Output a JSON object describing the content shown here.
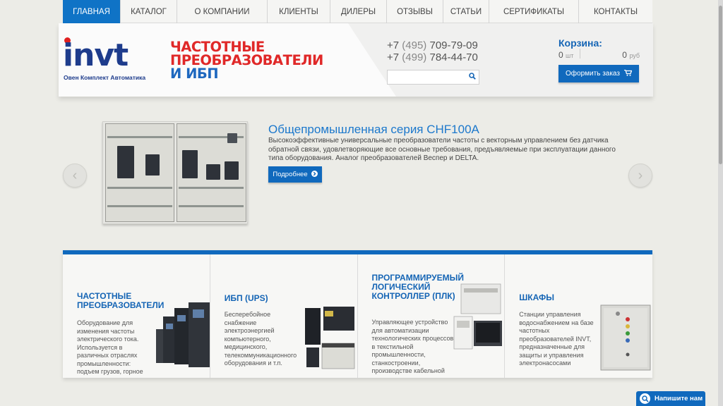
{
  "nav": {
    "items": [
      {
        "label": "Главная"
      },
      {
        "label": "Каталог"
      },
      {
        "label": "О компании"
      },
      {
        "label": "Клиенты"
      },
      {
        "label": "Дилеры"
      },
      {
        "label": "Отзывы"
      },
      {
        "label": "Статьи"
      },
      {
        "label": "Сертификаты"
      },
      {
        "label": "Контакты"
      }
    ]
  },
  "header": {
    "logo_text": "INVT",
    "logo_subtitle": "Овен Комплект Автоматика",
    "headline_line1": "ЧАСТОТНЫЕ",
    "headline_line2": "ПРЕОБРАЗОВАТЕЛИ",
    "headline_line3": "И ИБП",
    "phones": [
      {
        "prefix": "+7",
        "code": "(495)",
        "number": "709-79-09"
      },
      {
        "prefix": "+7",
        "code": "(499)",
        "number": "784-44-70"
      }
    ],
    "search": {
      "value": "",
      "placeholder": ""
    }
  },
  "cart": {
    "title": "Корзина:",
    "qty": "0",
    "qty_unit": "шт",
    "sum": "0",
    "sum_unit": "руб",
    "order_button": "Оформить заказ"
  },
  "slider": {
    "title": "Общепромышленная серия CHF100A",
    "description": "Высокоэффективные универсальные преобразователи частоты с векторным управлением без датчика обратной связи, удовлетворяющие все основные требования, предъявляемые при эксплуатации данного типа оборудования. Аналог преобразователей Веспер и DELTA.",
    "more_button": "Подробнее"
  },
  "categories": [
    {
      "title": "Частотные преобразователи",
      "description": "Оборудование для изменения частоты электрического тока. Используется в различных отраслях промышленности: подъем грузов, горное дело, металлургия и др."
    },
    {
      "title": "ИБП (UPS)",
      "description": "Бесперебойное снабжение электроэнергией компьютерного, медицинского, телекоммуникационного оборудования и т.п."
    },
    {
      "title": "Программируемый логический контроллер (ПЛК)",
      "description": "Управляющее устройство для автоматизации технологических процессов в текстильной промышленности, станкостроении, производстве кабельной продукции и так далее"
    },
    {
      "title": "Шкафы",
      "description": "Станции управления водоснабжением на базе частотных преобразователей INVT, предназначенные для защиты и управления электронасосами"
    }
  ],
  "chat": {
    "label": "Напишите нам"
  },
  "colors": {
    "accent": "#1069bd",
    "brand_red": "#e02828",
    "brand_blue": "#1e3c8c"
  }
}
